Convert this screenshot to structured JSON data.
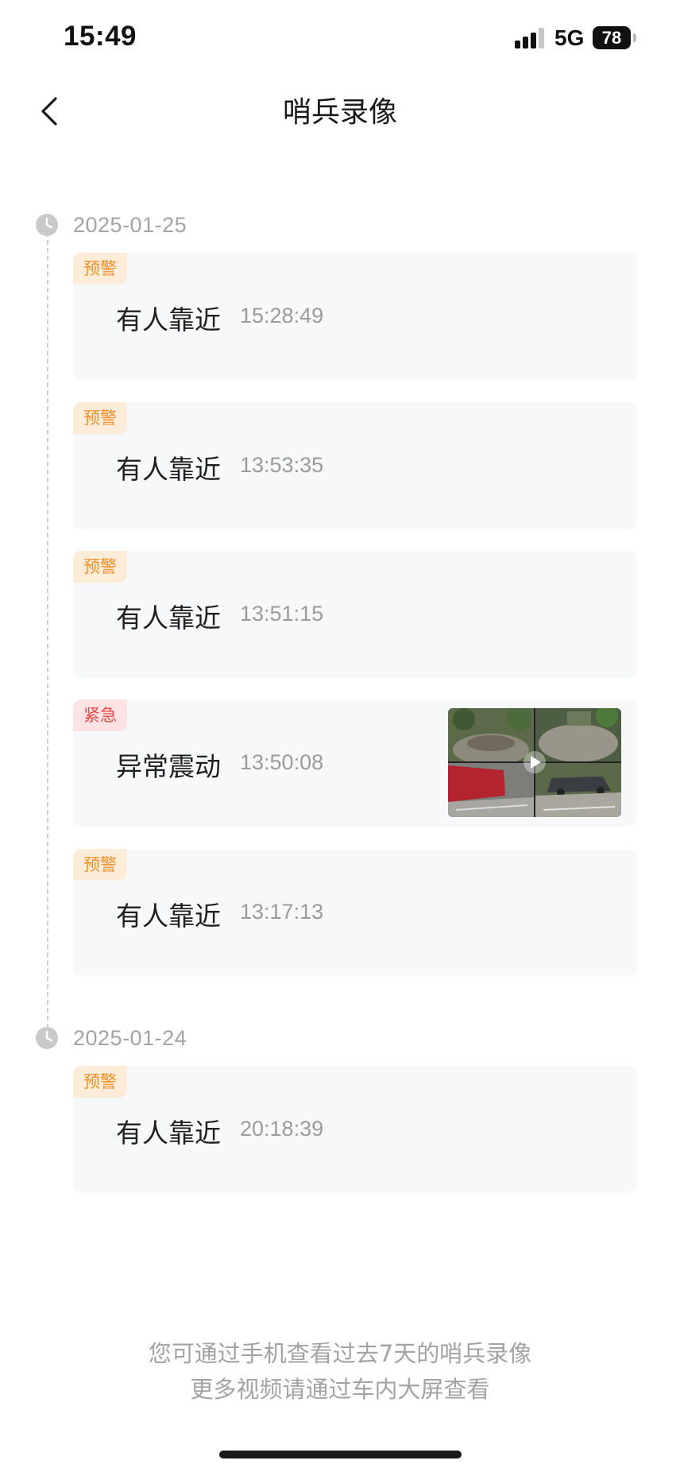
{
  "status_bar": {
    "time": "15:49",
    "network": "5G",
    "battery": "78"
  },
  "header": {
    "back_icon": "chevron-left-icon",
    "title": "哨兵录像"
  },
  "groups": [
    {
      "date": "2025-01-25",
      "events": [
        {
          "tag": "预警",
          "type": "warn",
          "name": "有人靠近",
          "time": "15:28:49"
        },
        {
          "tag": "预警",
          "type": "warn",
          "name": "有人靠近",
          "time": "13:53:35"
        },
        {
          "tag": "预警",
          "type": "warn",
          "name": "有人靠近",
          "time": "13:51:15"
        },
        {
          "tag": "紧急",
          "type": "urgent",
          "name": "异常震动",
          "time": "13:50:08",
          "has_thumbnail": true
        },
        {
          "tag": "预警",
          "type": "warn",
          "name": "有人靠近",
          "time": "13:17:13"
        }
      ]
    },
    {
      "date": "2025-01-24",
      "events": [
        {
          "tag": "预警",
          "type": "warn",
          "name": "有人靠近",
          "time": "20:18:39"
        }
      ]
    }
  ],
  "footer": {
    "line1": "您可通过手机查看过去7天的哨兵录像",
    "line2": "更多视频请通过车内大屏查看"
  },
  "colors": {
    "warn_tag_bg": "#fdecd8",
    "warn_tag_text": "#f0902a",
    "urgent_tag_bg": "#fde3e3",
    "urgent_tag_text": "#e84a4a",
    "card_bg": "#f7f8fa"
  }
}
